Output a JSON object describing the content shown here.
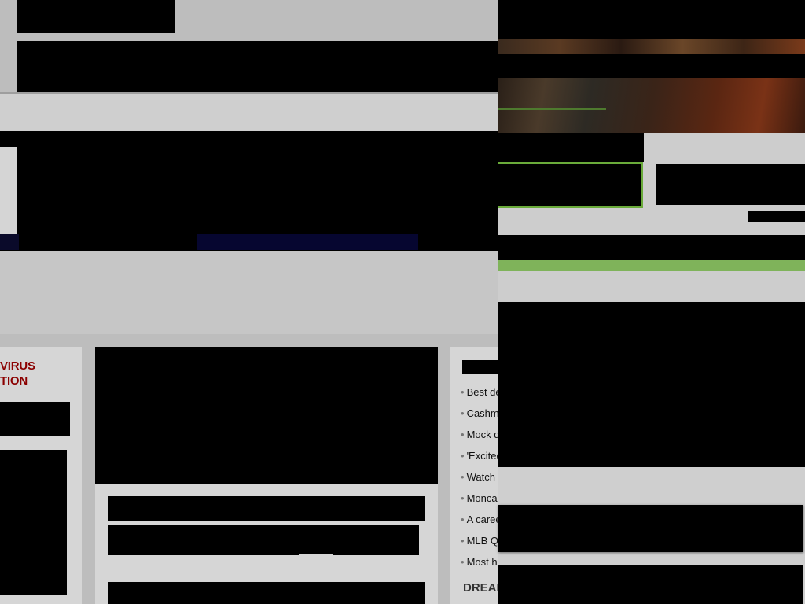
{
  "sidebar_left": {
    "covid_title_line1": "VIRUS",
    "covid_title_line2": "TION"
  },
  "headlines": {
    "items": [
      "Best de",
      "Cashm",
      "Mock d",
      "'Excited",
      "Watch",
      "Moncad",
      "A caree",
      "MLB Q",
      "Most h"
    ]
  },
  "dream": {
    "label": "DREAM"
  },
  "colors": {
    "covid_title": "#8b0000",
    "green_accent": "#6aab3a",
    "green_bar": "#7fb35a",
    "page_background": "#bdbdbd"
  }
}
